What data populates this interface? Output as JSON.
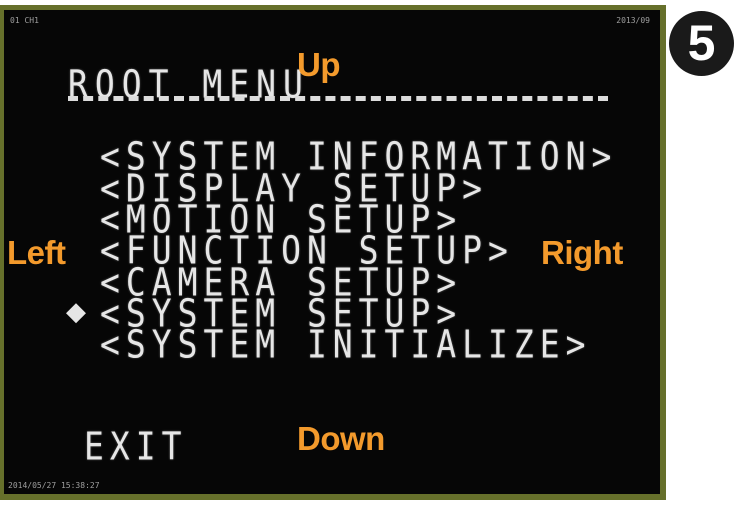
{
  "screen": {
    "osd_top_left": "01 CH1",
    "osd_top_right": "2013/09",
    "osd_bottom_left": "2014/05/27 15:38:27"
  },
  "menu": {
    "title": "ROOT MENU",
    "items": [
      {
        "label": "<SYSTEM INFORMATION>"
      },
      {
        "label": "<DISPLAY SETUP>"
      },
      {
        "label": "<MOTION SETUP>"
      },
      {
        "label": "<FUNCTION SETUP>"
      },
      {
        "label": "<CAMERA SETUP>"
      },
      {
        "label": "<SYSTEM SETUP>",
        "selected": true
      },
      {
        "label": "<SYSTEM INITIALIZE>"
      }
    ],
    "cursor_symbol": "◆",
    "exit_label": "EXIT"
  },
  "hints": {
    "up": "Up",
    "down": "Down",
    "left": "Left",
    "right": "Right"
  },
  "step_badge": "5",
  "colors": {
    "hint": "#f39a2c",
    "osd_text": "#e6e6e6",
    "screen_bg": "#060606",
    "frame": "#66702b",
    "badge_bg": "#1a1a1a"
  }
}
